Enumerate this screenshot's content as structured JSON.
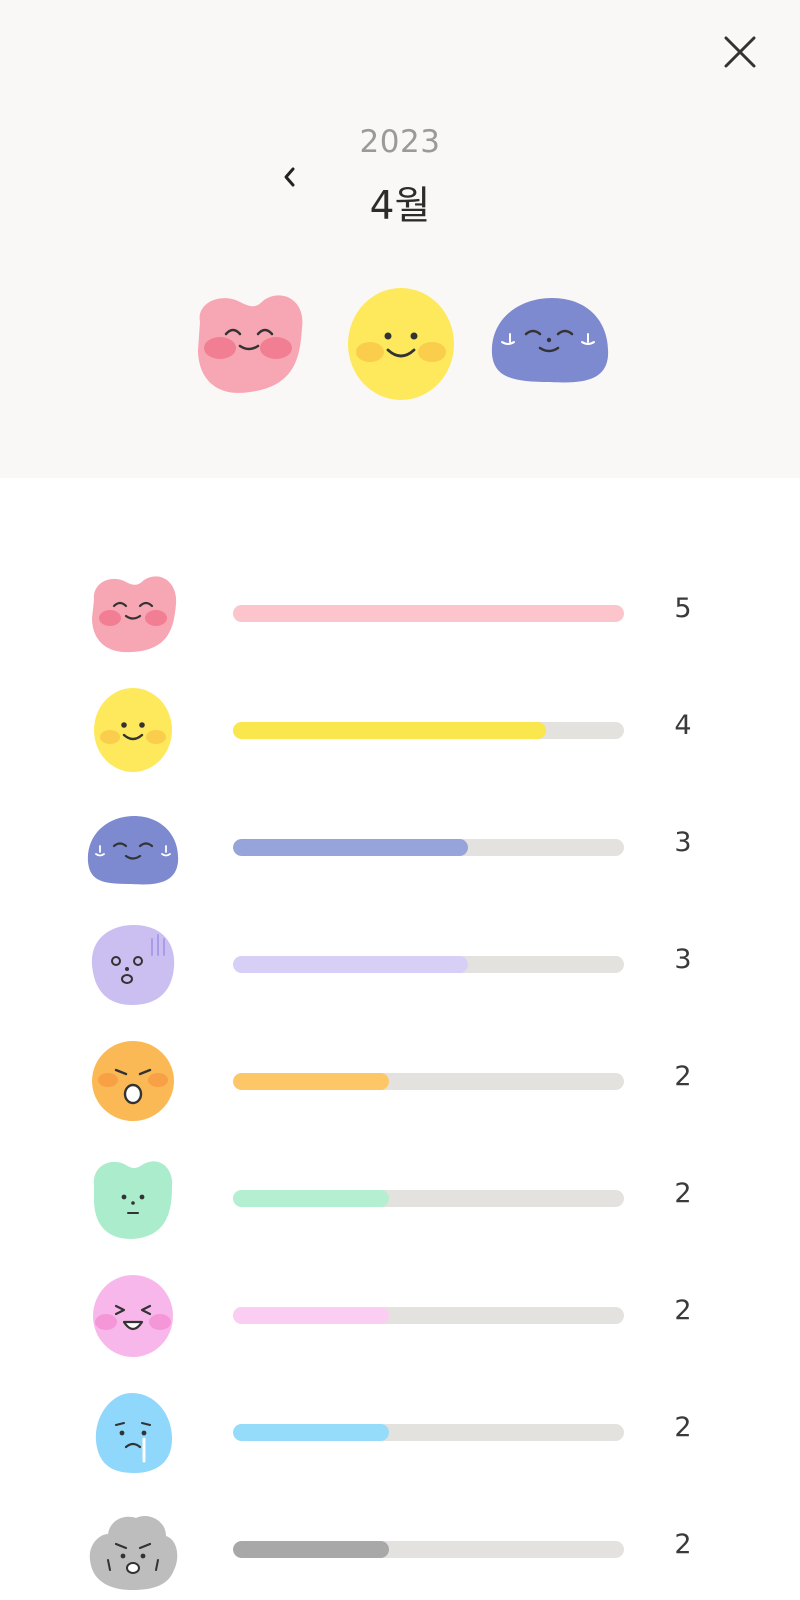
{
  "header": {
    "year": "2023",
    "month": "4월",
    "top_moods": [
      "love-mood",
      "happy-mood",
      "relieved-mood"
    ]
  },
  "colors": {
    "header_bg": "#faf8f6",
    "track_bg": "#e3e2df"
  },
  "moods": [
    {
      "mood": "love",
      "count": "5",
      "value": 5,
      "color": "#fcc5cb",
      "body": "#f7a6b3",
      "cheek": "#f06d86"
    },
    {
      "mood": "happy",
      "count": "4",
      "value": 4,
      "color": "#f9e74d",
      "body": "#fde95b",
      "cheek": "#f9c64a"
    },
    {
      "mood": "relieved",
      "count": "3",
      "value": 3,
      "color": "#97a4dc",
      "body": "#7d8ad0",
      "cheek": "#ffffff"
    },
    {
      "mood": "surprised",
      "count": "3",
      "value": 3,
      "color": "#d8cff6",
      "body": "#cbbff2",
      "cheek": "#a79bea"
    },
    {
      "mood": "upset",
      "count": "2",
      "value": 2,
      "color": "#fdc768",
      "body": "#fbb955",
      "cheek": "#f7a046"
    },
    {
      "mood": "calm",
      "count": "2",
      "value": 2,
      "color": "#b4efd2",
      "body": "#aaeccb",
      "cheek": "#aaeccb"
    },
    {
      "mood": "laughing",
      "count": "2",
      "value": 2,
      "color": "#fbcdf2",
      "body": "#f8b7ea",
      "cheek": "#f596d8"
    },
    {
      "mood": "sad",
      "count": "2",
      "value": 2,
      "color": "#94dcfa",
      "body": "#8fd7fb",
      "cheek": "#ffffff"
    },
    {
      "mood": "angry",
      "count": "2",
      "value": 2,
      "color": "#a8a8a8",
      "body": "#bdbdbd",
      "cheek": "#bdbdbd"
    }
  ],
  "max_value": 5
}
